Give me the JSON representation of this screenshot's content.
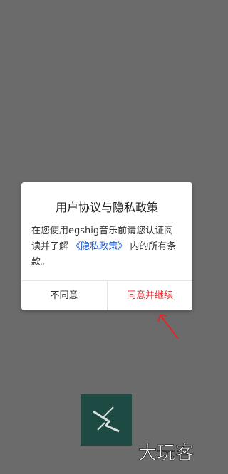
{
  "dialog": {
    "title": "用户协议与隐私政策",
    "body_text_before": "在您使用egshig音乐前请您认证阅读并了解",
    "body_link": "《隐私政策》",
    "body_text_after": "内的所有条款。",
    "decline_label": "不同意",
    "accept_label": "同意并继续"
  },
  "watermark_text": "大玩客",
  "app_logo_icon": "lightning-icon",
  "colors": {
    "overlay": "#6b6b6b",
    "link": "#1e56c8",
    "accept": "#e0262b",
    "arrow": "#e0262b",
    "logo_bg": "#1e4a44"
  }
}
